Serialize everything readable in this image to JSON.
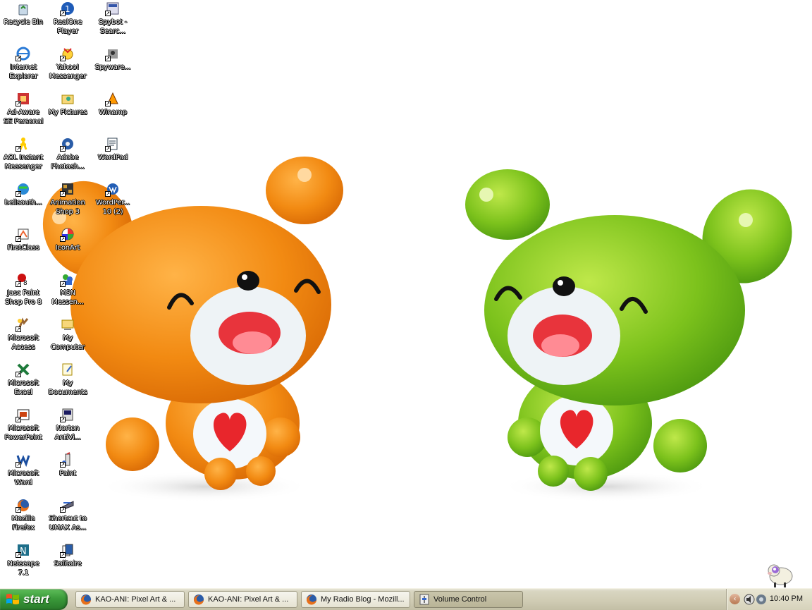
{
  "desktop": {
    "icons": [
      {
        "label": "Recycle Bin",
        "icon": "recycle-bin-icon"
      },
      {
        "label": "RealOne\nPlayer",
        "icon": "realone-player-icon"
      },
      {
        "label": "Spybot -\nSearc...",
        "icon": "spybot-icon"
      },
      {
        "label": "Internet\nExplorer",
        "icon": "internet-explorer-icon"
      },
      {
        "label": "Yahoo!\nMessenger",
        "icon": "yahoo-messenger-icon"
      },
      {
        "label": "Spyware...",
        "icon": "spyware-icon"
      },
      {
        "label": "Ad-Aware\nSE Personal",
        "icon": "ad-aware-icon"
      },
      {
        "label": "My Pictures",
        "icon": "my-pictures-icon"
      },
      {
        "label": "Winamp",
        "icon": "winamp-icon"
      },
      {
        "label": "AOL Instant\nMessenger",
        "icon": "aol-instant-messenger-icon"
      },
      {
        "label": "Adobe\nPhotosh...",
        "icon": "adobe-photoshop-icon"
      },
      {
        "label": "WordPad",
        "icon": "wordpad-icon"
      },
      {
        "label": "bellsouth...",
        "icon": "bellsouth-icon"
      },
      {
        "label": "Animation\nShop 3",
        "icon": "animation-shop-icon"
      },
      {
        "label": "WordPer...\n10 (2)",
        "icon": "wordperfect-icon"
      },
      {
        "label": "FirstClass",
        "icon": "firstclass-icon"
      },
      {
        "label": "IconArt",
        "icon": "iconart-icon"
      },
      {
        "label": "Jasc Paint\nShop Pro 8",
        "icon": "paint-shop-pro-icon"
      },
      {
        "label": "MSN\nMessen...",
        "icon": "msn-messenger-icon"
      },
      {
        "label": "Microsoft\nAccess",
        "icon": "microsoft-access-icon"
      },
      {
        "label": "My\nComputer",
        "icon": "my-computer-icon"
      },
      {
        "label": "Microsoft\nExcel",
        "icon": "microsoft-excel-icon"
      },
      {
        "label": "My\nDocuments",
        "icon": "my-documents-icon"
      },
      {
        "label": "Microsoft\nPowerPoint",
        "icon": "microsoft-powerpoint-icon"
      },
      {
        "label": "Norton\nAntiVi...",
        "icon": "norton-antivirus-icon"
      },
      {
        "label": "Microsoft\nWord",
        "icon": "microsoft-word-icon"
      },
      {
        "label": "Paint",
        "icon": "paint-icon"
      },
      {
        "label": "Mozilla\nFirefox",
        "icon": "mozilla-firefox-icon"
      },
      {
        "label": "Shortcut to\nUMAX As...",
        "icon": "umax-shortcut-icon"
      },
      {
        "label": "Netscape\n7.1",
        "icon": "netscape-icon"
      },
      {
        "label": "Solitaire",
        "icon": "solitaire-icon"
      }
    ]
  },
  "taskbar": {
    "start_label": "start",
    "tasks": [
      {
        "label": "KAO-ANI: Pixel Art & ...",
        "icon": "firefox-icon",
        "active": false
      },
      {
        "label": "KAO-ANI: Pixel Art & ...",
        "icon": "firefox-icon",
        "active": false
      },
      {
        "label": "My Radio Blog - Mozill...",
        "icon": "firefox-icon",
        "active": false
      },
      {
        "label": "Volume Control",
        "icon": "volume-control-icon",
        "active": true
      }
    ],
    "tray": {
      "clock": "10:40 PM",
      "icons": [
        "show-hidden-icons-arrow",
        "volume-icon",
        "network-icon"
      ]
    }
  },
  "colors": {
    "taskbar": "#d9d6c2",
    "start_button": "#3b9a3a",
    "bear_orange": "#f28a12",
    "bear_green": "#7cc21c"
  }
}
